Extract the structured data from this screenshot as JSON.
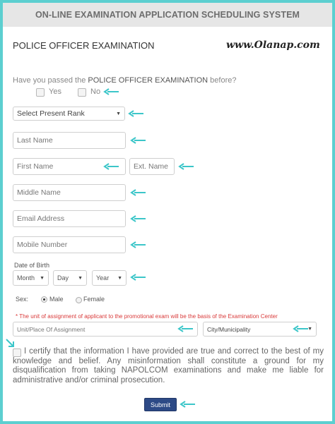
{
  "header": {
    "title": "ON-LINE EXAMINATION APPLICATION SCHEDULING SYSTEM"
  },
  "form": {
    "title": "POLICE OFFICER EXAMINATION",
    "watermark": "www.Olanap.com",
    "passed_question": {
      "prefix": "Have you passed the ",
      "emphasis": "POLICE OFFICER EXAMINATION",
      "suffix": " before?",
      "yes_label": "Yes",
      "no_label": "No"
    },
    "present_rank": {
      "value": "Select Present Rank"
    },
    "last_name": {
      "placeholder": "Last Name"
    },
    "first_name": {
      "placeholder": "First Name"
    },
    "ext_name": {
      "placeholder": "Ext. Name"
    },
    "middle_name": {
      "placeholder": "Middle Name"
    },
    "email": {
      "placeholder": "Email Address"
    },
    "mobile": {
      "placeholder": "Mobile Number"
    },
    "dob": {
      "label": "Date of Birth",
      "month": "Month",
      "day": "Day",
      "year": "Year"
    },
    "sex": {
      "label": "Sex:",
      "male": "Male",
      "female": "Female",
      "selected": "Male"
    },
    "assignment_note": "* The unit of assignment of applicant to the promotional exam will be the basis of the Examination Center",
    "unit_assignment": {
      "placeholder": "Unit/Place Of Assignment"
    },
    "city": {
      "value": "City/Municipality"
    },
    "certification": "I certify that the information I have provided are true and correct to the best of my knowledge and belief. Any misinformation shall constitute a ground for my disqualification from taking NAPOLCOM examinations and make me liable for administrative and/or criminal prosecution.",
    "submit_label": "Submit"
  },
  "colors": {
    "annotation_arrow": "#3cc6c9",
    "border": "#5ccfd0",
    "submit_bg": "#2d4a86",
    "note_red": "#d93a3a"
  }
}
